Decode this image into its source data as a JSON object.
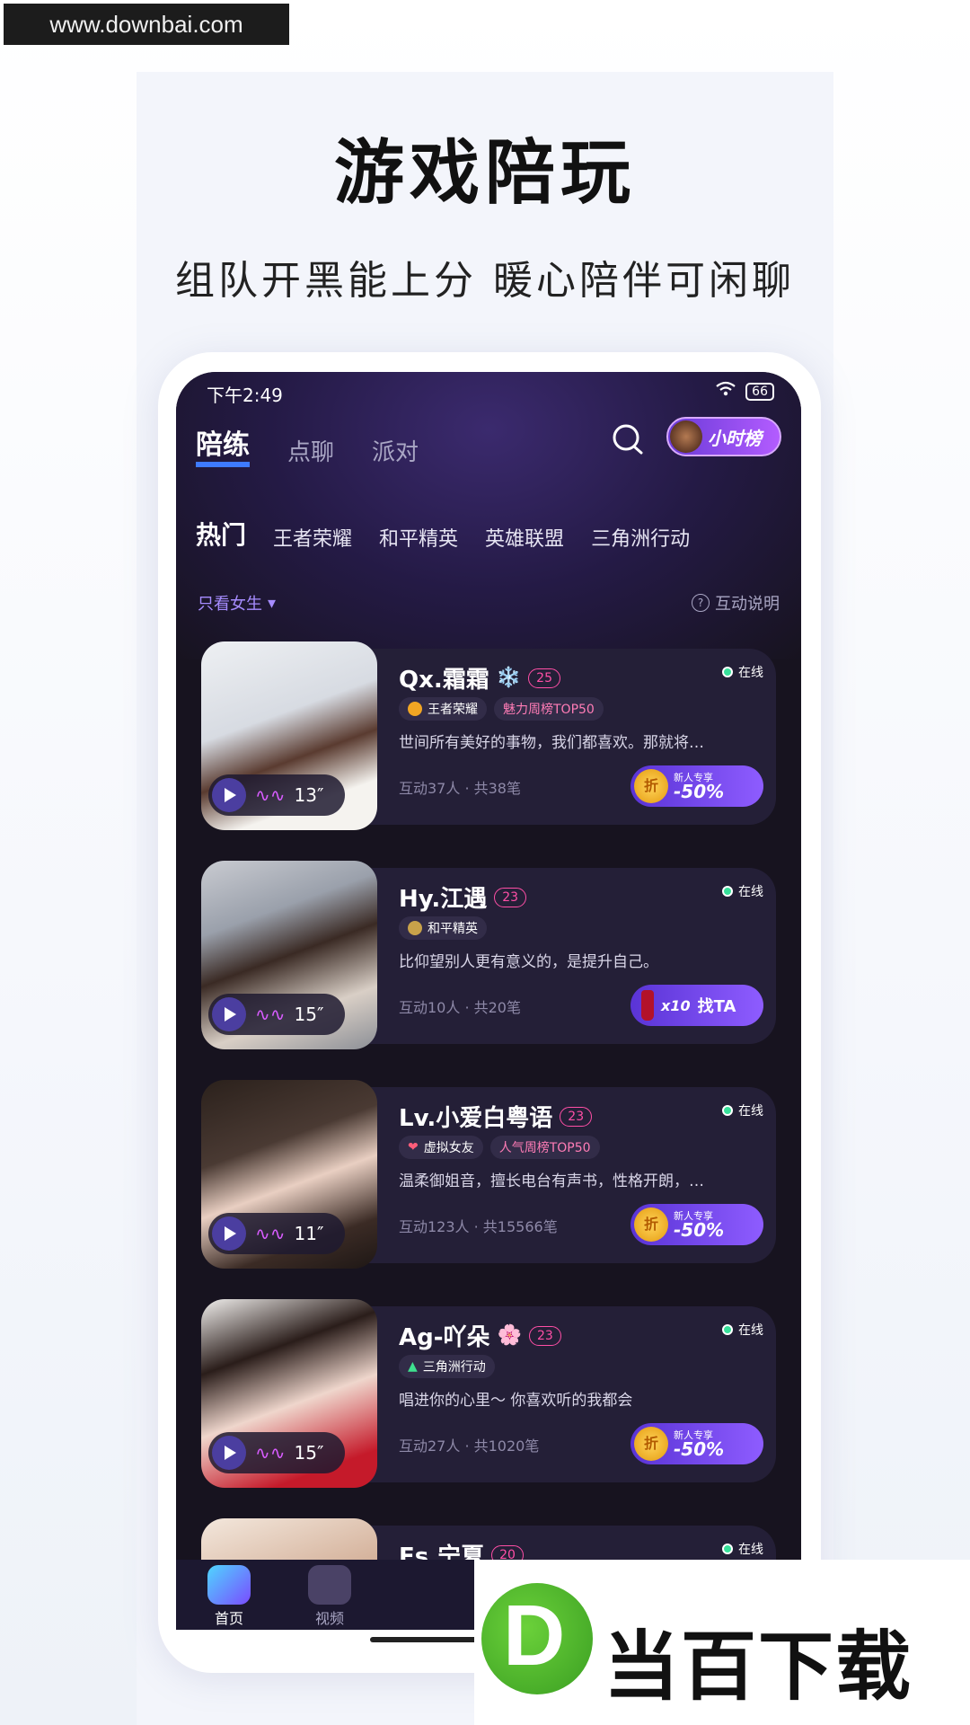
{
  "watermark_top": "www.downbai.com",
  "hero": {
    "title": "游戏陪玩",
    "subtitle": "组队开黑能上分 暖心陪伴可闲聊"
  },
  "status_bar": {
    "time": "下午2:49",
    "battery": "66"
  },
  "top_tabs": [
    "陪练",
    "点聊",
    "派对"
  ],
  "rank_button": "小时榜",
  "categories": [
    "热门",
    "王者荣耀",
    "和平精英",
    "英雄联盟",
    "三角洲行动"
  ],
  "filter_label": "只看女生",
  "help_label": "互动说明",
  "online_label": "在线",
  "cards": [
    {
      "name": "Qx.霜霜",
      "name_emoji": "❄️",
      "level": "25",
      "tags": [
        "王者荣耀",
        "魅力周榜TOP50"
      ],
      "desc": "世间所有美好的事物，我们都喜欢。那就将…",
      "stats": "互动37人 · 共38笔",
      "voice": "13″",
      "promo_small": "新人专享",
      "promo_big": "-50%",
      "coin": "折"
    },
    {
      "name": "Hy.江遇",
      "level": "23",
      "tags": [
        "和平精英"
      ],
      "desc": "比仰望别人更有意义的，是提升自己。",
      "stats": "互动10人 · 共20笔",
      "voice": "15″",
      "find_times": "x10",
      "find_label": "找TA"
    },
    {
      "name": "Lv.小爱白粤语",
      "level": "23",
      "tags": [
        "虚拟女友",
        "人气周榜TOP50"
      ],
      "desc": "温柔御姐音，擅长电台有声书，性格开朗，…",
      "stats": "互动123人 · 共15566笔",
      "voice": "11″",
      "promo_small": "新人专享",
      "promo_big": "-50%",
      "coin": "折"
    },
    {
      "name": "Ag-吖朵",
      "name_emoji": "🌸",
      "level": "23",
      "tags": [
        "三角洲行动"
      ],
      "desc": "唱进你的心里～ 你喜欢听的我都会",
      "stats": "互动27人 · 共1020笔",
      "voice": "15″",
      "promo_small": "新人专享",
      "promo_big": "-50%",
      "coin": "折"
    },
    {
      "name": "Es.宁夏",
      "level": "20"
    }
  ],
  "bottom_nav": [
    "首页",
    "视频"
  ],
  "watermark_br": "当百下载",
  "colors": {
    "accent": "#8e5cff",
    "online": "#37e09a",
    "level": "#ff4fa6"
  }
}
